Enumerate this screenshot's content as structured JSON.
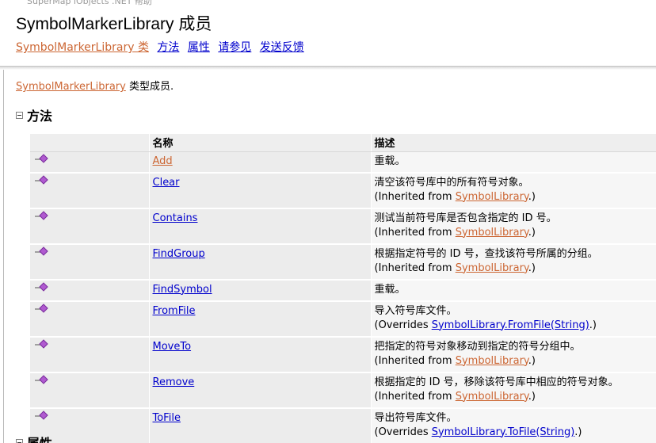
{
  "header": {
    "top_text": "SuperMap iObjects .NET 帮助",
    "title": "SymbolMarkerLibrary 成员",
    "nav": [
      {
        "label": "SymbolMarkerLibrary 类"
      },
      {
        "label": "方法"
      },
      {
        "label": "属性"
      },
      {
        "label": "请参见"
      },
      {
        "label": "发送反馈"
      }
    ]
  },
  "intro": {
    "link": "SymbolMarkerLibrary",
    "text": " 类型成员."
  },
  "sections": {
    "methods": "方法",
    "properties": "属性"
  },
  "table": {
    "headers": {
      "name": "名称",
      "description": "描述"
    },
    "rows": [
      {
        "name": "Add",
        "desc": "重载。",
        "note_prefix": "",
        "note_link": "",
        "note_suffix": ""
      },
      {
        "name": "Clear",
        "desc": "清空该符号库中的所有符号对象。",
        "note_prefix": "(Inherited from ",
        "note_link": "SymbolLibrary",
        "note_suffix": ".)"
      },
      {
        "name": "Contains",
        "desc": "测试当前符号库是否包含指定的 ID 号。",
        "note_prefix": "(Inherited from ",
        "note_link": "SymbolLibrary",
        "note_suffix": ".)"
      },
      {
        "name": "FindGroup",
        "desc": "根据指定符号的 ID 号，查找该符号所属的分组。",
        "note_prefix": "(Inherited from ",
        "note_link": "SymbolLibrary",
        "note_suffix": ".)"
      },
      {
        "name": "FindSymbol",
        "desc": "重载。",
        "note_prefix": "",
        "note_link": "",
        "note_suffix": ""
      },
      {
        "name": "FromFile",
        "desc": "导入符号库文件。",
        "note_prefix": "(Overrides ",
        "note_link": "SymbolLibrary.FromFile(String)",
        "note_suffix": ".)"
      },
      {
        "name": "MoveTo",
        "desc": "把指定的符号对象移动到指定的符号分组中。",
        "note_prefix": "(Inherited from ",
        "note_link": "SymbolLibrary",
        "note_suffix": ".)"
      },
      {
        "name": "Remove",
        "desc": "根据指定的 ID 号，移除该符号库中相应的符号对象。",
        "note_prefix": "(Inherited from ",
        "note_link": "SymbolLibrary",
        "note_suffix": ".)"
      },
      {
        "name": "ToFile",
        "desc": "导出符号库文件。",
        "note_prefix": "(Overrides ",
        "note_link": "SymbolLibrary.ToFile(String)",
        "note_suffix": ".)"
      }
    ]
  },
  "colors": {
    "link": "#0000cc",
    "visited_link": "#cc6633",
    "row_bg": "#ececec",
    "method_icon": "#b05ad0"
  },
  "icons": {
    "method": "public-method-icon",
    "collapse": "collapse-icon"
  }
}
